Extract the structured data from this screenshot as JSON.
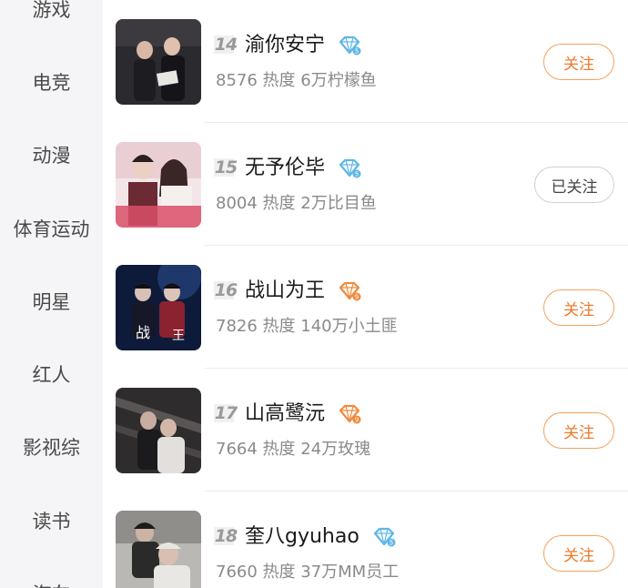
{
  "sidebar": {
    "items": [
      {
        "label": "游戏"
      },
      {
        "label": "电竞"
      },
      {
        "label": "动漫"
      },
      {
        "label": "体育运动"
      },
      {
        "label": "明星"
      },
      {
        "label": "红人"
      },
      {
        "label": "影视综"
      },
      {
        "label": "读书"
      },
      {
        "label": "汽车"
      }
    ]
  },
  "list": {
    "rows": [
      {
        "rank": "14",
        "name": "渝你安宁",
        "badge_icon": "diamond-blue-icon",
        "badge_color": "#5fb6e8",
        "meta": "8576 热度 6万柠檬鱼",
        "follow_label": "关注",
        "followed": false
      },
      {
        "rank": "15",
        "name": "无予伦毕",
        "badge_icon": "diamond-blue-icon",
        "badge_color": "#5fb6e8",
        "meta": "8004 热度 2万比目鱼",
        "follow_label": "已关注",
        "followed": true
      },
      {
        "rank": "16",
        "name": "战山为王",
        "badge_icon": "diamond-orange-icon",
        "badge_color": "#f08a3c",
        "meta": "7826 热度 140万小土匪",
        "follow_label": "关注",
        "followed": false
      },
      {
        "rank": "17",
        "name": "山高鹭沅",
        "badge_icon": "diamond-orange-icon",
        "badge_color": "#f08a3c",
        "meta": "7664 热度 24万玫瑰",
        "follow_label": "关注",
        "followed": false
      },
      {
        "rank": "18",
        "name": "奎八gyuhao",
        "badge_icon": "diamond-blue-icon",
        "badge_color": "#5fb6e8",
        "meta": "7660 热度 37万MM员工",
        "follow_label": "关注",
        "followed": false
      }
    ]
  }
}
